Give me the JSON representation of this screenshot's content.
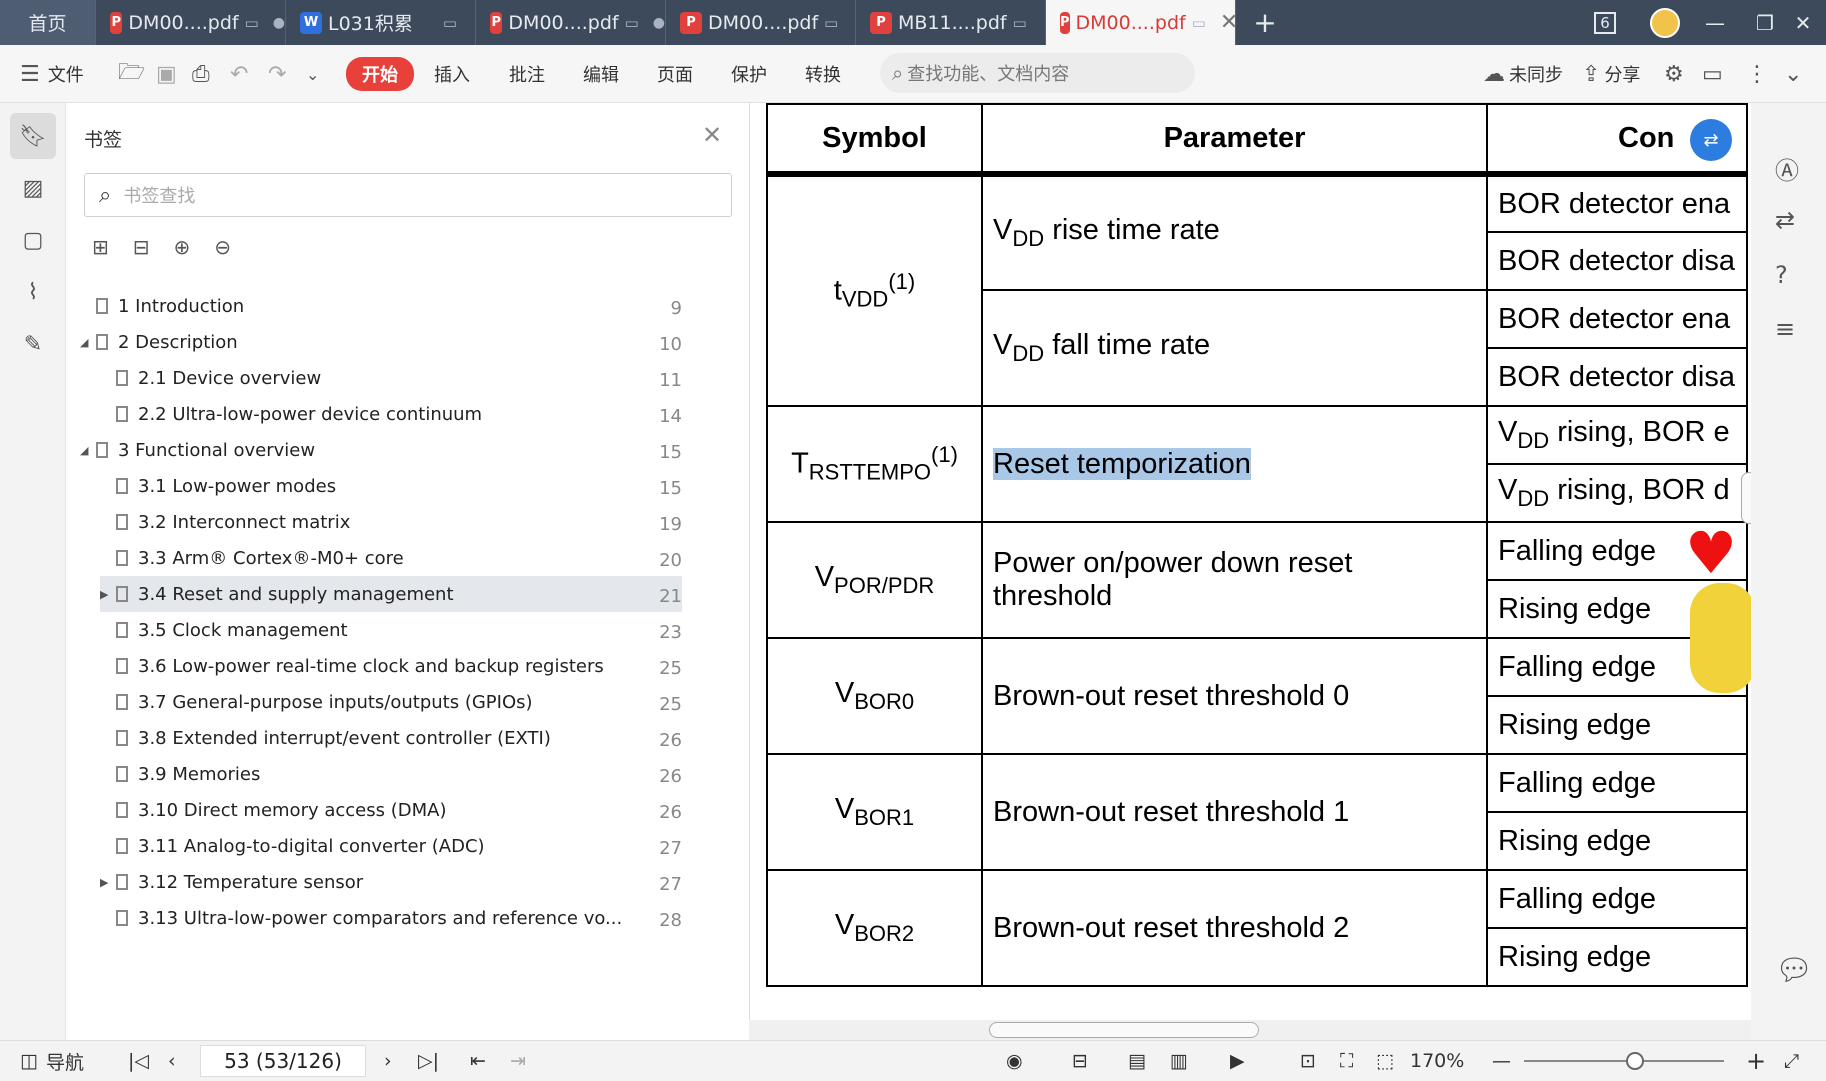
{
  "tabs": [
    {
      "label": "首页"
    },
    {
      "label": "DM00....pdf"
    },
    {
      "label": "L031积累"
    },
    {
      "label": "DM00....pdf"
    },
    {
      "label": "DM00....pdf"
    },
    {
      "label": "MB11....pdf"
    },
    {
      "label": "DM00....pdf"
    }
  ],
  "tab_count": "6",
  "toolbar": {
    "file": "文件",
    "start": "开始",
    "menus": [
      "插入",
      "批注",
      "编辑",
      "页面",
      "保护",
      "转换"
    ],
    "search_placeholder": "查找功能、文档内容",
    "sync": "未同步",
    "share": "分享"
  },
  "panel": {
    "title": "书签",
    "search_placeholder": "书签查找",
    "bookmarks": [
      {
        "label": "1 Introduction",
        "page": "9"
      },
      {
        "label": "2 Description",
        "page": "10"
      },
      {
        "label": "2.1 Device overview",
        "page": "11"
      },
      {
        "label": "2.2 Ultra-low-power device continuum",
        "page": "14"
      },
      {
        "label": "3 Functional overview",
        "page": "15"
      },
      {
        "label": "3.1 Low-power modes",
        "page": "15"
      },
      {
        "label": "3.2 Interconnect matrix",
        "page": "19"
      },
      {
        "label": "3.3 Arm® Cortex®-M0+ core",
        "page": "20"
      },
      {
        "label": "3.4 Reset and supply management",
        "page": "21"
      },
      {
        "label": "3.5 Clock management",
        "page": "23"
      },
      {
        "label": "3.6 Low-power real-time clock and backup registers",
        "page": "25"
      },
      {
        "label": "3.7 General-purpose inputs/outputs (GPIOs)",
        "page": "25"
      },
      {
        "label": "3.8 Extended interrupt/event controller (EXTI)",
        "page": "26"
      },
      {
        "label": "3.9 Memories",
        "page": "26"
      },
      {
        "label": "3.10 Direct memory access (DMA)",
        "page": "26"
      },
      {
        "label": "3.11 Analog-to-digital converter (ADC)",
        "page": "27"
      },
      {
        "label": "3.12 Temperature sensor",
        "page": "27"
      },
      {
        "label": "3.13 Ultra-low-power comparators and reference vo...",
        "page": "28"
      }
    ]
  },
  "table": {
    "headers": [
      "Symbol",
      "Parameter",
      "Con"
    ],
    "t_vdd": {
      "sym": "t",
      "sub": "VDD",
      "sup": "(1)"
    },
    "vdd_rise": "rise time rate",
    "vdd_fall": "fall time rate",
    "v": "V",
    "dd": "DD",
    "bor_ena": "BOR detector ena",
    "bor_dis": "BOR detector disa",
    "trst": {
      "sym": "T",
      "sub": "RSTTEMPO",
      "sup": "(1)"
    },
    "reset_temp": "Reset temporization",
    "vdd_rising_bor_e": "rising, BOR e",
    "vdd_rising_bor_d": "rising, BOR d",
    "vpor": {
      "sym": "V",
      "sub": "POR/PDR"
    },
    "power_reset": "Power on/power down reset threshold",
    "falling": "Falling edge",
    "rising": "Rising edge",
    "vbor0": {
      "sym": "V",
      "sub": "BOR0"
    },
    "vbor1": {
      "sym": "V",
      "sub": "BOR1"
    },
    "vbor2": {
      "sym": "V",
      "sub": "BOR2"
    },
    "bor0": "Brown-out reset threshold 0",
    "bor1": "Brown-out reset threshold 1",
    "bor2": "Brown-out reset threshold 2"
  },
  "status": {
    "nav": "导航",
    "page": "53 (53/126)",
    "zoom": "170%"
  }
}
